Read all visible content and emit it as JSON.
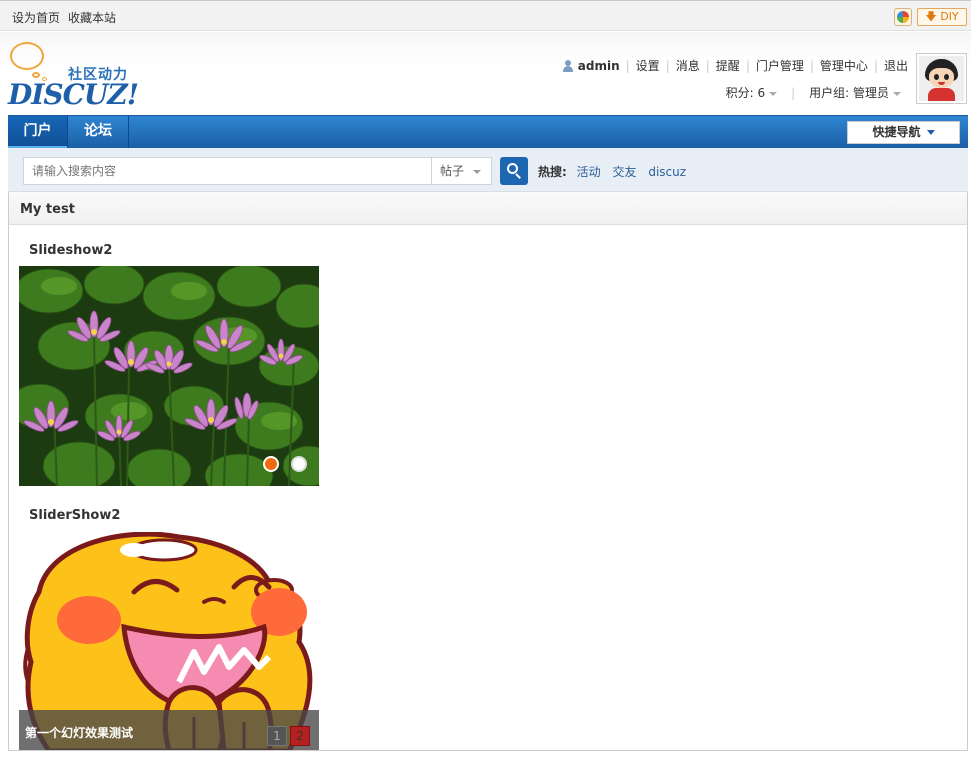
{
  "topbar": {
    "set_home": "设为首页",
    "bookmark": "收藏本站",
    "diy_label": "DIY"
  },
  "logo": {
    "cn": "社区动力",
    "en": "DISCUZ!"
  },
  "usermenu": {
    "username": "admin",
    "items": [
      "设置",
      "消息",
      "提醒",
      "门户管理",
      "管理中心",
      "退出"
    ]
  },
  "stats": {
    "credits": "积分: 6",
    "usergroup": "用户组: 管理员"
  },
  "nav": {
    "tabs": [
      "门户",
      "论坛"
    ],
    "active_tab": "门户",
    "quick_nav": "快捷导航"
  },
  "search": {
    "placeholder": "请输入搜索内容",
    "type": "帖子",
    "hot_label": "热搜:",
    "hot_keywords": [
      "活动",
      "交友",
      "discuz"
    ]
  },
  "frame": {
    "title": "My test",
    "blocks": [
      {
        "title": "Slideshow2",
        "dots_total": 2,
        "active_dot": 1
      },
      {
        "title": "SliderShow2",
        "caption": "第一个幻灯效果测试",
        "pages": [
          "1",
          "2"
        ],
        "active_page": "2"
      }
    ]
  },
  "colors": {
    "nav_blue": "#1a5fa7",
    "active_dot": "#f06b10",
    "active_page": "#b52020",
    "link": "#2a5f95"
  },
  "icons": [
    "user-icon",
    "theme-icon",
    "download-arrow-icon",
    "search-icon",
    "caret-down-icon"
  ]
}
